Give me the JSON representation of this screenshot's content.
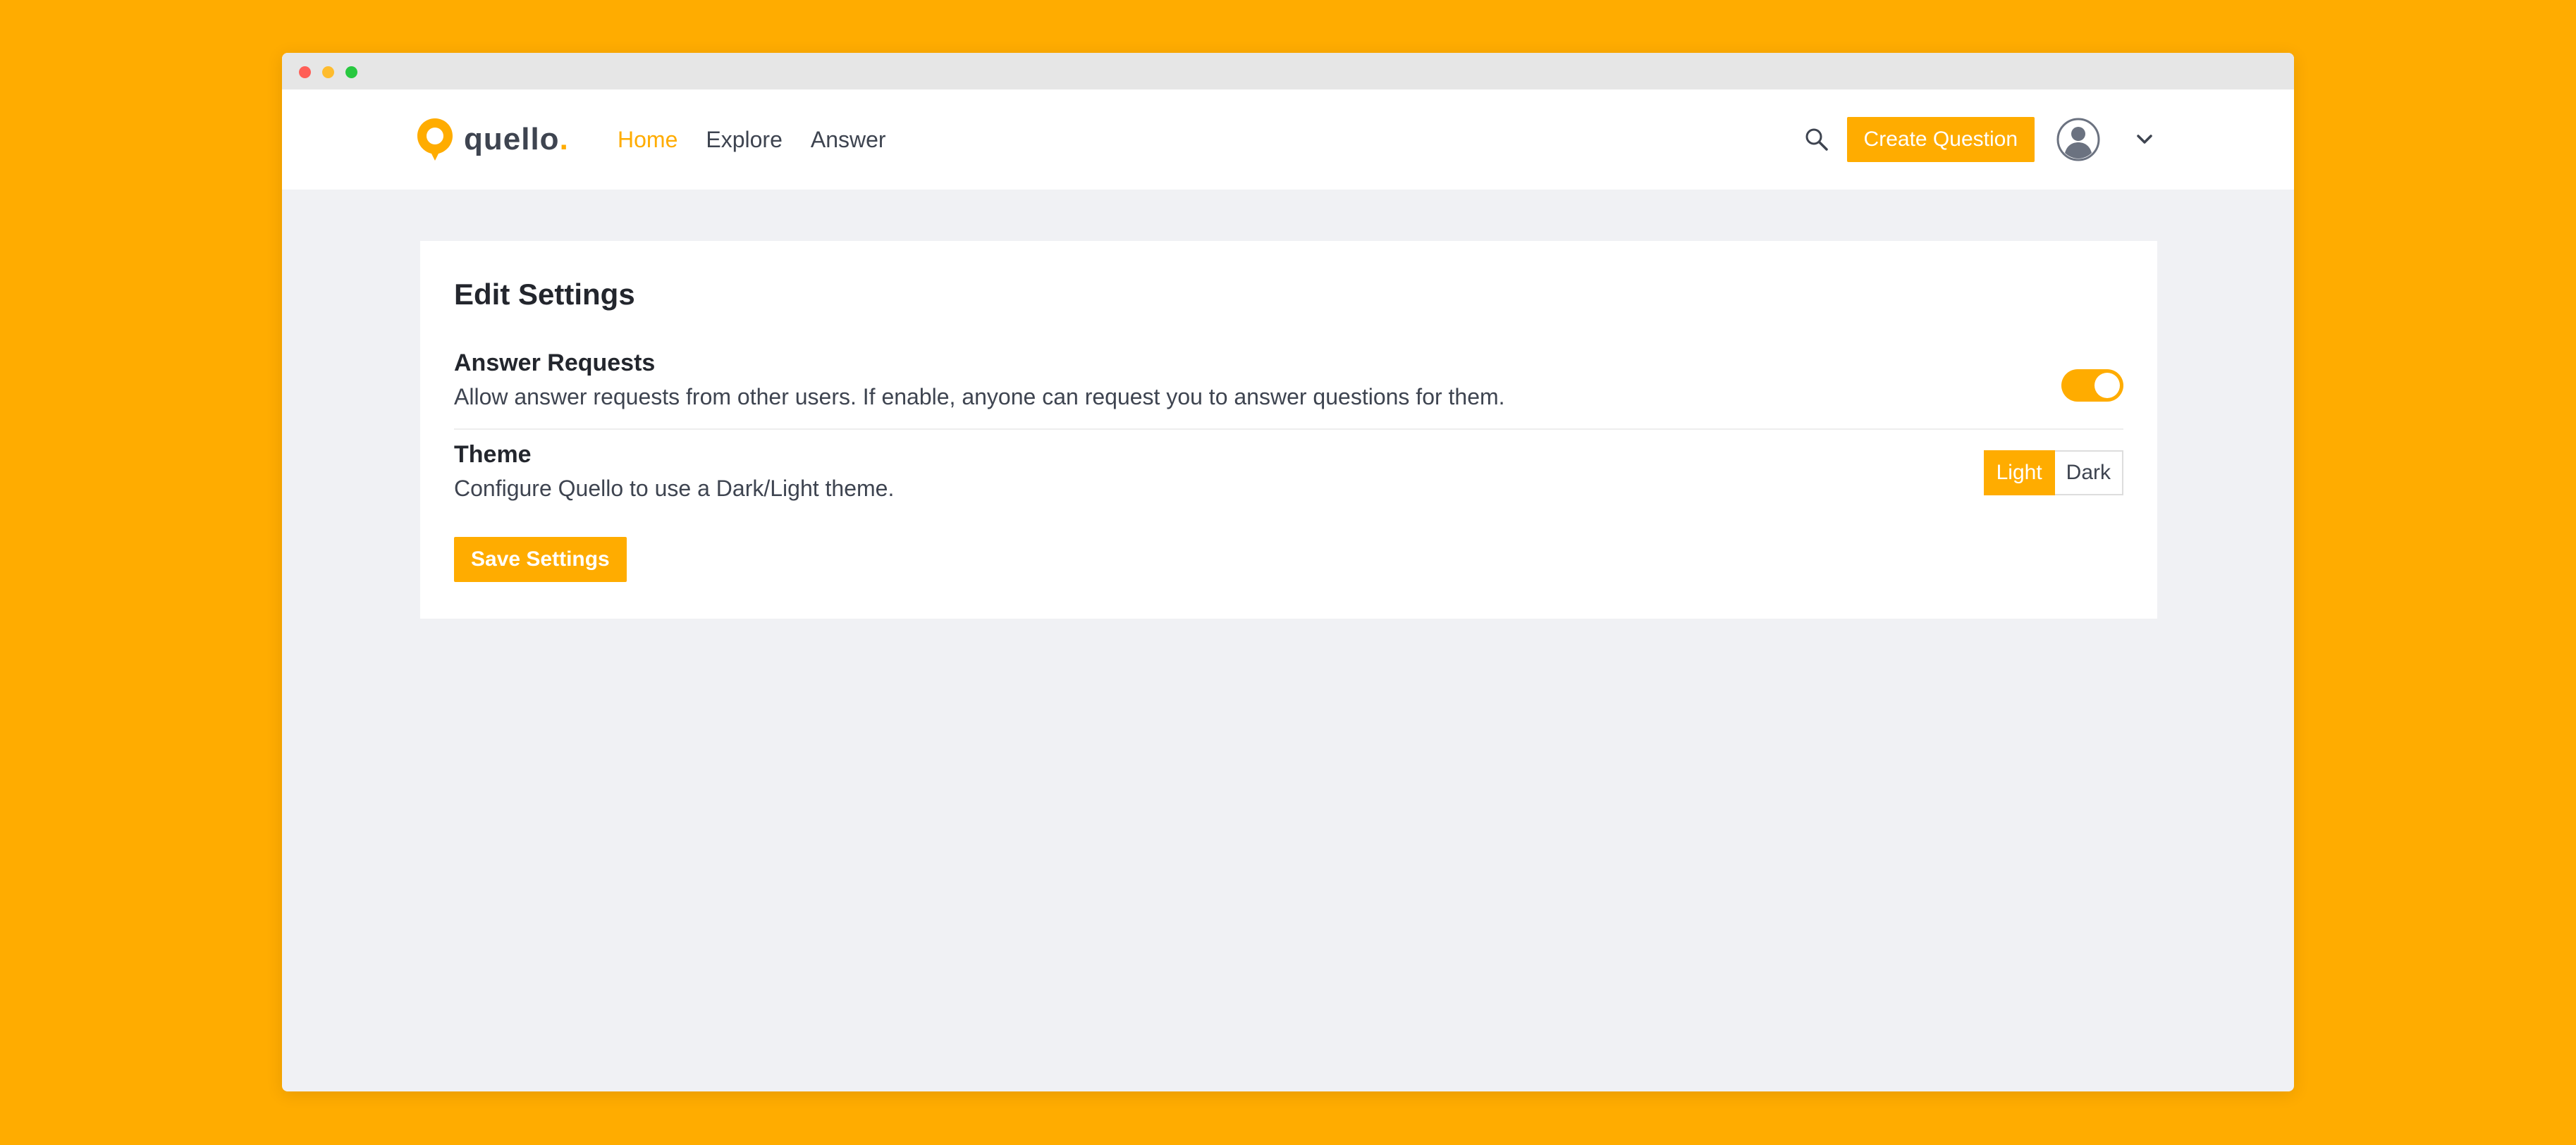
{
  "colors": {
    "background": "#FFAC00",
    "accent": "#FFAC00",
    "window_bg": "#F0F1F4",
    "text_dark": "#23262D",
    "text_body": "#3E4450"
  },
  "window": {
    "controls": [
      "close",
      "minimize",
      "maximize"
    ]
  },
  "navbar": {
    "brand": {
      "name": "quello",
      "dot": ".",
      "icon": "location-pin-logo"
    },
    "links": [
      {
        "label": "Home",
        "active": true
      },
      {
        "label": "Explore",
        "active": false
      },
      {
        "label": "Answer",
        "active": false
      }
    ],
    "search_icon": "search-icon",
    "create_button": "Create Question",
    "avatar_icon": "user-avatar-icon",
    "menu_icon": "chevron-down-icon"
  },
  "settings": {
    "title": "Edit Settings",
    "answer_requests": {
      "title": "Answer Requests",
      "description": "Allow answer requests from other users. If enable, anyone can request you to answer questions for them.",
      "enabled": true
    },
    "theme": {
      "title": "Theme",
      "description": "Configure Quello to use a Dark/Light theme.",
      "options": [
        "Light",
        "Dark"
      ],
      "selected": "Light"
    },
    "save_button": "Save Settings"
  }
}
